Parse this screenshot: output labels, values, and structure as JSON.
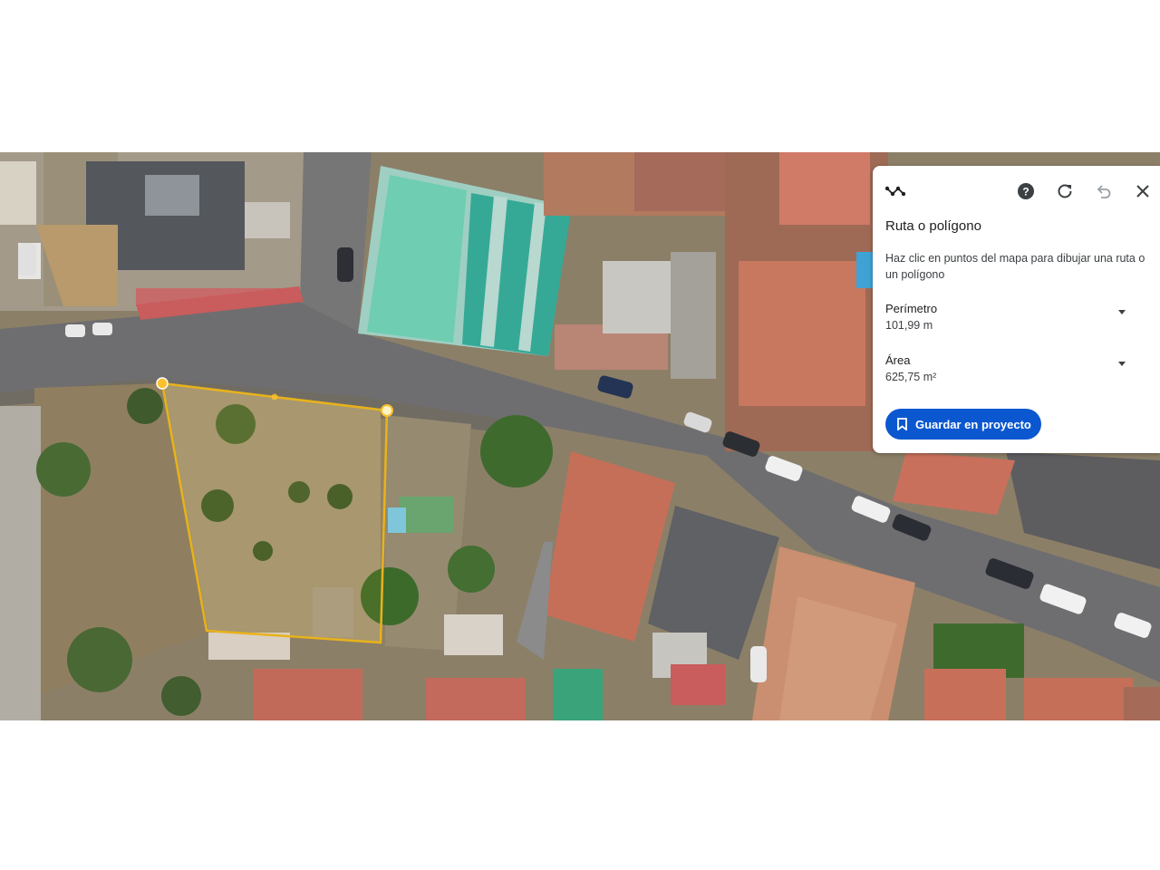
{
  "panel": {
    "title": "Ruta o polígono",
    "description": "Haz clic en puntos del mapa para dibujar una ruta o un polígono",
    "perimeter": {
      "label": "Perímetro",
      "value": "101,99 m"
    },
    "area": {
      "label": "Área",
      "value": "625,75 m²"
    },
    "save_label": "Guardar en proyecto",
    "icons": [
      "measure-path-icon",
      "help-icon",
      "refresh-icon",
      "undo-icon",
      "close-icon"
    ]
  },
  "colors": {
    "accent": "#0b57d0",
    "polygon_outline": "#e8b21c",
    "vertex_fill": "#fbc02d"
  }
}
